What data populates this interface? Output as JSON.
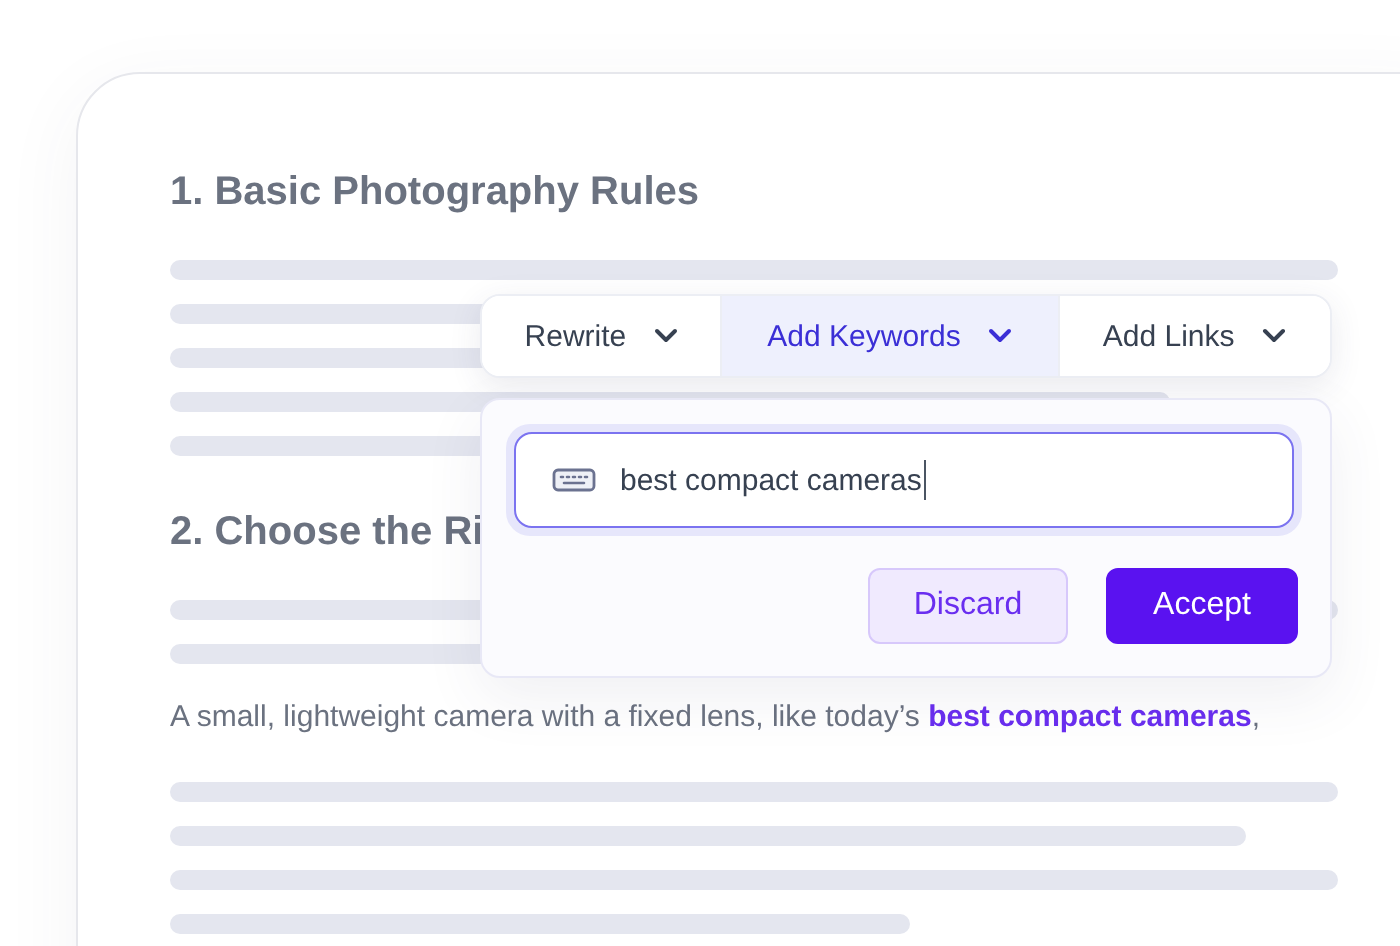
{
  "article": {
    "headings": [
      "1. Basic Photography Rules",
      "2. Choose the Ri"
    ],
    "paragraph": "A small, lightweight camera with a fixed lens, like today’s **best compact cameras**,"
  },
  "toolbar": {
    "tabs": [
      {
        "label": "Rewrite",
        "selected": false
      },
      {
        "label": "Add Keywords",
        "selected": true
      },
      {
        "label": "Add Links",
        "selected": false
      }
    ]
  },
  "keyword_panel": {
    "value": "best compact cameras",
    "buttons": [
      {
        "label": "Discard",
        "kind": "secondary"
      },
      {
        "label": "Accept",
        "kind": "primary"
      }
    ]
  }
}
